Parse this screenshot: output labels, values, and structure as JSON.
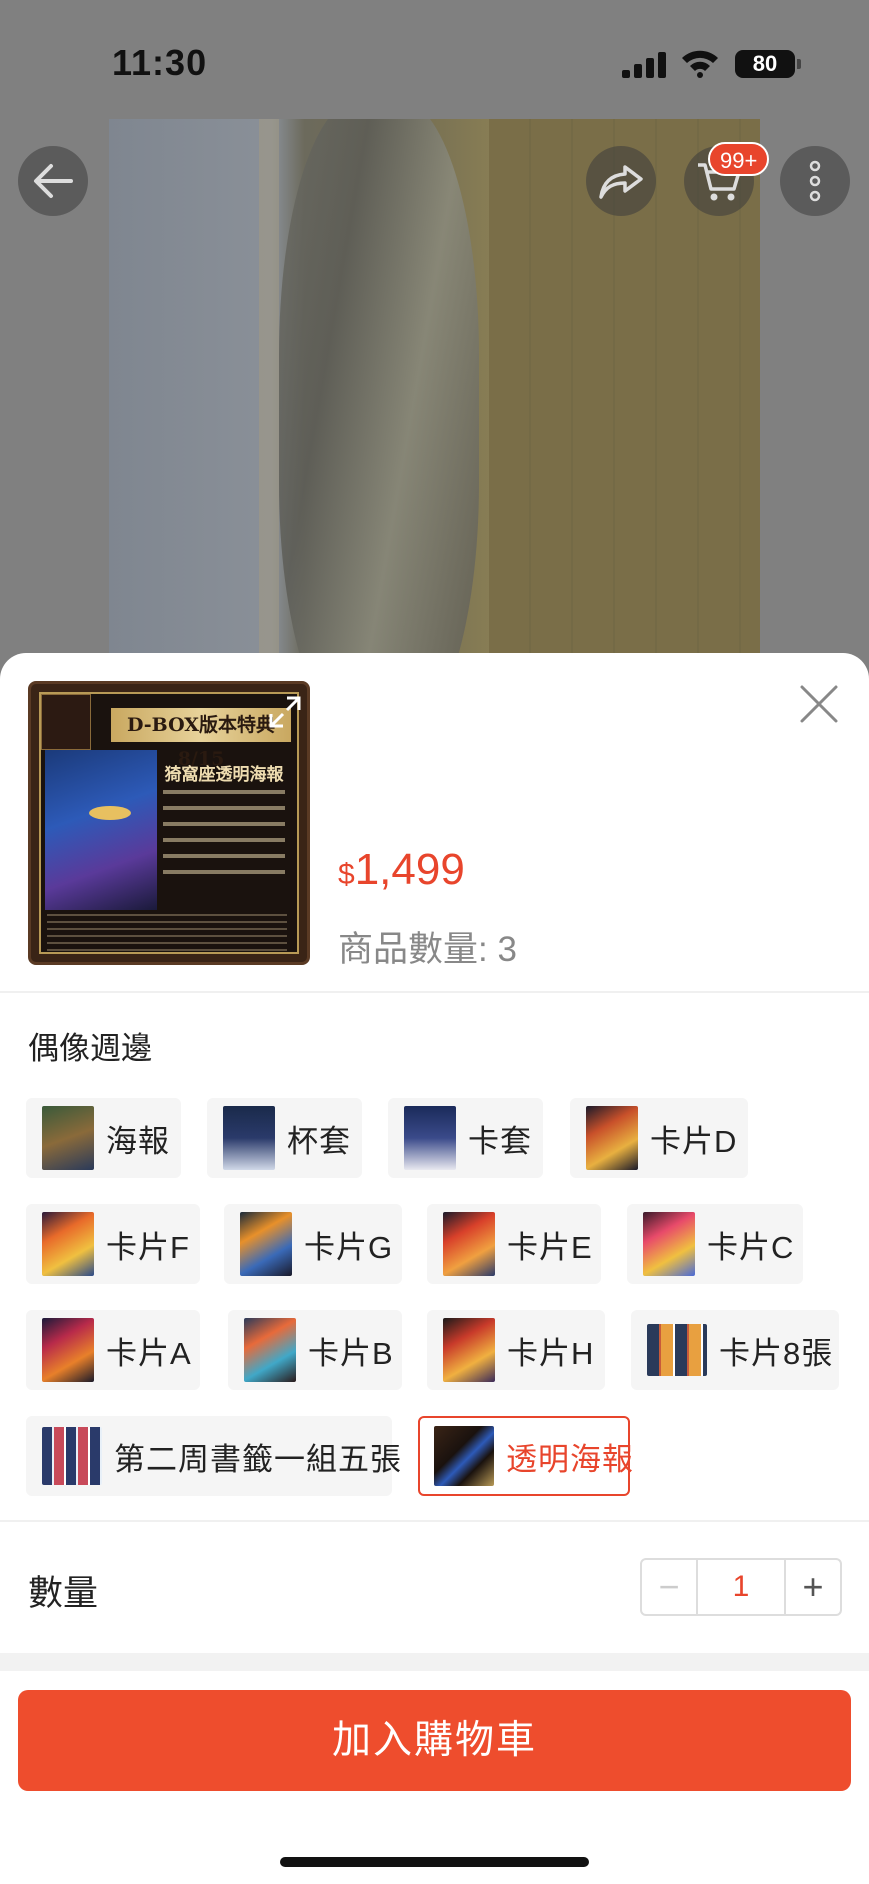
{
  "status_bar": {
    "time": "11:30",
    "battery": "80"
  },
  "header": {
    "cart_badge": "99+"
  },
  "product": {
    "thumb_banner": "D-BOX版本特典 8/15",
    "thumb_title": "猗窩座透明海報",
    "price_currency": "$",
    "price": "1,499",
    "stock_label": "商品數量: 3"
  },
  "variation": {
    "title": "偶像週邊",
    "options": [
      {
        "label": "海報"
      },
      {
        "label": "杯套"
      },
      {
        "label": "卡套"
      },
      {
        "label": "卡片D"
      },
      {
        "label": "卡片F"
      },
      {
        "label": "卡片G"
      },
      {
        "label": "卡片E"
      },
      {
        "label": "卡片C"
      },
      {
        "label": "卡片A"
      },
      {
        "label": "卡片B"
      },
      {
        "label": "卡片H"
      },
      {
        "label": "卡片8張"
      },
      {
        "label": "第二周書籤一組五張"
      },
      {
        "label": "透明海報",
        "selected": true
      }
    ]
  },
  "quantity": {
    "label": "數量",
    "value": "1",
    "minus": "−",
    "plus": "+"
  },
  "cta": {
    "label": "加入購物車"
  },
  "colors": {
    "accent": "#ee4d2d",
    "price": "#e8452c"
  }
}
